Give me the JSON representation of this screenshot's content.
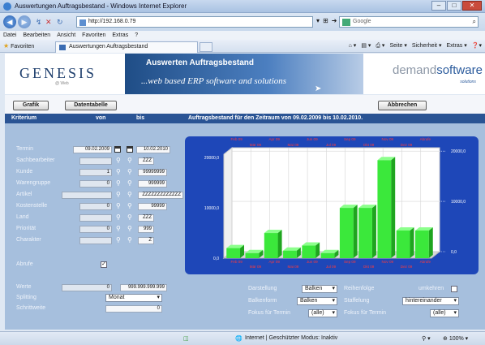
{
  "browser": {
    "window_title": "Auswertungen Auftragsbestand - Windows Internet Explorer",
    "address": "http://192.168.0.79",
    "search_placeholder": "Google",
    "menu": [
      "Datei",
      "Bearbeiten",
      "Ansicht",
      "Favoriten",
      "Extras",
      "?"
    ],
    "favorites_label": "Favoriten",
    "tab_title": "Auswertungen Auftragsbestand",
    "commands": [
      "Seite ▾",
      "Sicherheit ▾",
      "Extras ▾"
    ],
    "status_text": "Internet | Geschützter Modus: Inaktiv",
    "zoom": "100%"
  },
  "header": {
    "logo": "GENESIS",
    "logo_sub": "@ Web",
    "banner_title": "Auswerten Auftragsbestand",
    "banner_tagline": "...web based ERP software and solutions",
    "vendor_a": "demand",
    "vendor_b": "software",
    "vendor_sub": "solutions"
  },
  "buttons": {
    "grafik": "Grafik",
    "datentabelle": "Datentabelle",
    "abbrechen": "Abbrechen"
  },
  "table_head": {
    "kriterium": "Kriterium",
    "von": "von",
    "bis": "bis",
    "title": "Auftragsbestand für den Zeitraum von 09.02.2009 bis 10.02.2010."
  },
  "criteria": [
    {
      "label": "Termin",
      "von": "09.02.2009",
      "bis": "10.02.2010"
    },
    {
      "label": "Sachbearbeiter",
      "von": "",
      "bis": ""
    },
    {
      "label": "Kunde",
      "von": "1",
      "bis": "99999999"
    },
    {
      "label": "Warengruppe",
      "von": "0",
      "bis": "999999"
    },
    {
      "label": "Artikel",
      "von": "",
      "bis": "ZZZZZZZZZZZZZ"
    },
    {
      "label": "Kostenstelle",
      "von": "0",
      "bis": "99999"
    },
    {
      "label": "Land",
      "von": "",
      "bis": "ZZZ"
    },
    {
      "label": "Priorität",
      "von": "0",
      "bis": "999"
    },
    {
      "label": "Charakter",
      "von": "",
      "bis": "Z"
    }
  ],
  "criteria_top_bis": "ZZZ",
  "abrufe_label": "Abrufe",
  "abrufe_checked": "✓",
  "werte_label": "Werte",
  "werte_von": "0",
  "werte_bis": "999.999.999.999",
  "splitting_label": "Splitting",
  "splitting_value": "Monat",
  "schrittweite_label": "Schrittweite",
  "schrittweite_value": "0",
  "options": {
    "darstellung_label": "Darstellung",
    "darstellung_value": "Balken",
    "reihenfolge_label": "Reihenfolge",
    "umkehren_label": "umkehren",
    "balkenform_label": "Balkenform",
    "balkenform_value": "Balken",
    "staffelung_label": "Staffelung",
    "staffelung_value": "hintereinander",
    "fokus1_label": "Fokus für Termin",
    "fokus1_value": "(alle)",
    "fokus2_label": "Fokus für Termin",
    "fokus2_value": "(alle)"
  },
  "chart_data": {
    "type": "bar",
    "categories": [
      "Feb 09",
      "Mär 09",
      "Apr 09",
      "Mai 09",
      "Jun 09",
      "Jul 09",
      "Sep 09",
      "Okt 09",
      "Nov 09",
      "Dez 09",
      "Abrufe"
    ],
    "values": [
      2000,
      1000,
      5000,
      1500,
      2500,
      1000,
      10000,
      10000,
      19500,
      5500,
      5500
    ],
    "left_axis_ticks": [
      "0,0",
      "10000,0",
      "20000,0"
    ],
    "right_axis_ticks": [
      "0,0",
      "10000,0",
      "20000,0"
    ],
    "ylim": [
      0,
      21000
    ],
    "bar_color": "#3be83b"
  }
}
